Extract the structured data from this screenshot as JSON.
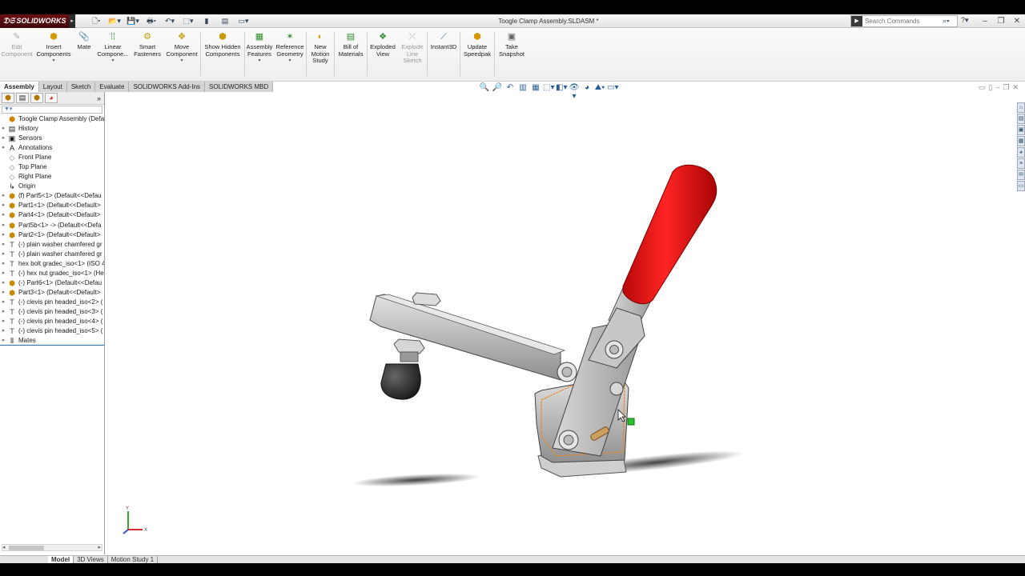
{
  "app": {
    "logo": "SOLIDWORKS",
    "document_title": "Toogle Clamp Assembly.SLDASM *"
  },
  "search": {
    "placeholder": "Search Commands"
  },
  "command_manager": [
    {
      "label": "Edit Component",
      "icon": "edit-component-icon",
      "enabled": false
    },
    {
      "label": "Insert Components",
      "icon": "insert-components-icon",
      "enabled": true
    },
    {
      "label": "Mate",
      "icon": "mate-icon",
      "enabled": true
    },
    {
      "label": "Linear Compone...",
      "icon": "linear-pattern-icon",
      "enabled": true
    },
    {
      "label": "Smart Fasteners",
      "icon": "smart-fasteners-icon",
      "enabled": true
    },
    {
      "label": "Move Component",
      "icon": "move-component-icon",
      "enabled": true
    },
    {
      "label": "Show Hidden Components",
      "icon": "show-hidden-icon",
      "enabled": true
    },
    {
      "label": "Assembly Features",
      "icon": "assembly-features-icon",
      "enabled": true
    },
    {
      "label": "Reference Geometry",
      "icon": "reference-geometry-icon",
      "enabled": true
    },
    {
      "label": "New Motion Study",
      "icon": "motion-study-icon",
      "enabled": true
    },
    {
      "label": "Bill of Materials",
      "icon": "bill-of-materials-icon",
      "enabled": true
    },
    {
      "label": "Exploded View",
      "icon": "exploded-view-icon",
      "enabled": true
    },
    {
      "label": "Explode Line Sketch",
      "icon": "explode-line-icon",
      "enabled": false
    },
    {
      "label": "Instant3D",
      "icon": "instant3d-icon",
      "enabled": true
    },
    {
      "label": "Update Speedpak",
      "icon": "speedpak-icon",
      "enabled": true
    },
    {
      "label": "Take Snapshot",
      "icon": "snapshot-icon",
      "enabled": true
    }
  ],
  "tabs": [
    "Assembly",
    "Layout",
    "Sketch",
    "Evaluate",
    "SOLIDWORKS Add-Ins",
    "SOLIDWORKS MBD"
  ],
  "active_tab": "Assembly",
  "tree": [
    {
      "label": "Toogle Clamp Assembly  (Default",
      "icon": "assembly-icon"
    },
    {
      "label": "History",
      "icon": "history-icon"
    },
    {
      "label": "Sensors",
      "icon": "sensors-icon"
    },
    {
      "label": "Annotations",
      "icon": "annotations-icon"
    },
    {
      "label": "Front Plane",
      "icon": "plane-icon"
    },
    {
      "label": "Top Plane",
      "icon": "plane-icon"
    },
    {
      "label": "Right Plane",
      "icon": "plane-icon"
    },
    {
      "label": "Origin",
      "icon": "origin-icon"
    },
    {
      "label": "(f) Part5<1> (Default<<Defau",
      "icon": "part-icon"
    },
    {
      "label": "Part1<1> (Default<<Default>",
      "icon": "part-icon"
    },
    {
      "label": "Part4<1> (Default<<Default>",
      "icon": "part-icon"
    },
    {
      "label": "Part5b<1> -> (Default<<Defa",
      "icon": "part-icon"
    },
    {
      "label": "Part2<1> (Default<<Default>",
      "icon": "part-icon"
    },
    {
      "label": "(-) plain washer chamfered gr",
      "icon": "toolbox-icon"
    },
    {
      "label": "(-) plain washer chamfered gr",
      "icon": "toolbox-icon"
    },
    {
      "label": "hex bolt gradec_iso<1> (ISO 4",
      "icon": "toolbox-icon"
    },
    {
      "label": "(-) hex nut gradec_iso<1> (He",
      "icon": "toolbox-icon"
    },
    {
      "label": "(-) Part6<1> (Default<<Defau",
      "icon": "part-icon"
    },
    {
      "label": "Part3<1> (Default<<Default>",
      "icon": "part-icon"
    },
    {
      "label": "(-) clevis pin headed_iso<2> (",
      "icon": "toolbox-icon"
    },
    {
      "label": "(-) clevis pin headed_iso<3> (",
      "icon": "toolbox-icon"
    },
    {
      "label": "(-) clevis pin headed_iso<4> (",
      "icon": "toolbox-icon"
    },
    {
      "label": "(-) clevis pin headed_iso<5> (",
      "icon": "toolbox-icon"
    },
    {
      "label": "Mates",
      "icon": "mates-icon"
    }
  ],
  "bottom_tabs": [
    "Model",
    "3D Views",
    "Motion Study 1"
  ],
  "active_bottom_tab": "Model",
  "triad": {
    "y_label": "Y",
    "x_label": "X"
  },
  "colors": {
    "handle_red": "#d41414",
    "body_gray": "#bdbdbd",
    "rubber_black": "#2a2a2a",
    "selection_orange": "#e8872a",
    "logo_maroon": "#5a0c10"
  }
}
